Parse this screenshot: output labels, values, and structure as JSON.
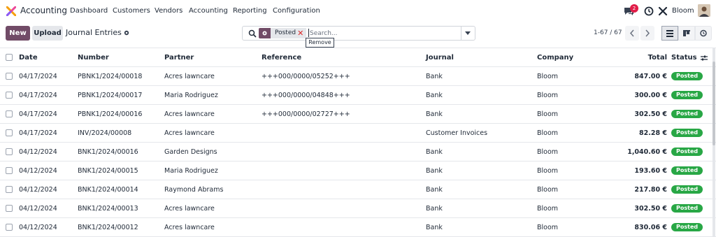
{
  "app": {
    "name": "Accounting"
  },
  "nav": {
    "menu": [
      "Dashboard",
      "Customers",
      "Vendors",
      "Accounting",
      "Reporting",
      "Configuration"
    ],
    "chat_badge": "2",
    "company": "Bloom"
  },
  "control": {
    "new_label": "New",
    "upload_label": "Upload",
    "breadcrumb": "Journal Entries",
    "facet_label": "Posted",
    "search_placeholder": "Search...",
    "tooltip": "Remove",
    "pager": "1-67 / 67"
  },
  "table": {
    "headers": {
      "date": "Date",
      "number": "Number",
      "partner": "Partner",
      "reference": "Reference",
      "journal": "Journal",
      "company": "Company",
      "total": "Total",
      "status": "Status"
    },
    "rows": [
      {
        "date": "04/17/2024",
        "number": "PBNK1/2024/00018",
        "partner": "Acres lawncare",
        "reference": "+++000/0000/05252+++",
        "journal": "Bank",
        "company": "Bloom",
        "total": "847.00 €",
        "status": "Posted"
      },
      {
        "date": "04/17/2024",
        "number": "PBNK1/2024/00017",
        "partner": "Maria Rodriguez",
        "reference": "+++000/0000/04848+++",
        "journal": "Bank",
        "company": "Bloom",
        "total": "300.00 €",
        "status": "Posted"
      },
      {
        "date": "04/17/2024",
        "number": "PBNK1/2024/00016",
        "partner": "Acres lawncare",
        "reference": "+++000/0000/02727+++",
        "journal": "Bank",
        "company": "Bloom",
        "total": "302.50 €",
        "status": "Posted"
      },
      {
        "date": "04/17/2024",
        "number": "INV/2024/00008",
        "partner": "Acres lawncare",
        "reference": "",
        "journal": "Customer Invoices",
        "company": "Bloom",
        "total": "82.28 €",
        "status": "Posted"
      },
      {
        "date": "04/12/2024",
        "number": "BNK1/2024/00016",
        "partner": "Garden Designs",
        "reference": "",
        "journal": "Bank",
        "company": "Bloom",
        "total": "1,040.60 €",
        "status": "Posted"
      },
      {
        "date": "04/12/2024",
        "number": "BNK1/2024/00015",
        "partner": "Maria Rodriguez",
        "reference": "",
        "journal": "Bank",
        "company": "Bloom",
        "total": "193.60 €",
        "status": "Posted"
      },
      {
        "date": "04/12/2024",
        "number": "BNK1/2024/00014",
        "partner": "Raymond Abrams",
        "reference": "",
        "journal": "Bank",
        "company": "Bloom",
        "total": "217.80 €",
        "status": "Posted"
      },
      {
        "date": "04/12/2024",
        "number": "BNK1/2024/00013",
        "partner": "Acres lawncare",
        "reference": "",
        "journal": "Bank",
        "company": "Bloom",
        "total": "302.50 €",
        "status": "Posted"
      },
      {
        "date": "04/12/2024",
        "number": "BNK1/2024/00012",
        "partner": "Acres lawncare",
        "reference": "",
        "journal": "Bank",
        "company": "Bloom",
        "total": "830.06 €",
        "status": "Posted"
      }
    ]
  },
  "colors": {
    "brand": "#714b67",
    "status_posted": "#28a745",
    "facet_remove": "#dc2626",
    "badge": "#e11d48"
  },
  "icons": [
    "app-logo-icon",
    "chat-icon",
    "clock-icon",
    "tools-icon",
    "gear-icon",
    "search-icon",
    "chevron-left-icon",
    "chevron-right-icon",
    "list-view-icon",
    "kanban-view-icon",
    "activity-view-icon",
    "column-settings-icon"
  ]
}
